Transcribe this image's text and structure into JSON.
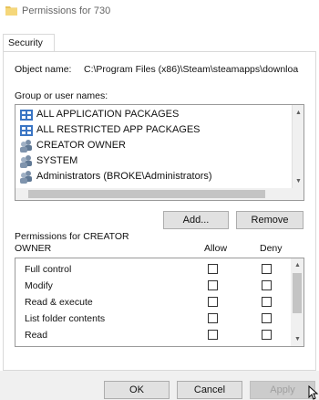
{
  "window": {
    "title": "Permissions for 730"
  },
  "tabs": [
    {
      "label": "Security"
    }
  ],
  "object": {
    "label": "Object name:",
    "value": "C:\\Program Files (x86)\\Steam\\steamapps\\downloa"
  },
  "groups": {
    "label": "Group or user names:",
    "items": [
      {
        "name": "ALL APPLICATION PACKAGES",
        "icon": "package-group-icon"
      },
      {
        "name": "ALL RESTRICTED APP PACKAGES",
        "icon": "package-group-icon"
      },
      {
        "name": "CREATOR OWNER",
        "icon": "users-icon"
      },
      {
        "name": "SYSTEM",
        "icon": "users-icon"
      },
      {
        "name": "Administrators (BROKE\\Administrators)",
        "icon": "users-icon"
      }
    ]
  },
  "buttons": {
    "add": "Add...",
    "remove": "Remove",
    "ok": "OK",
    "cancel": "Cancel",
    "apply": "Apply"
  },
  "permissions": {
    "label_line1": "Permissions for CREATOR",
    "label_line2": "OWNER",
    "allow_header": "Allow",
    "deny_header": "Deny",
    "rows": [
      {
        "name": "Full control",
        "allow": false,
        "deny": false
      },
      {
        "name": "Modify",
        "allow": false,
        "deny": false
      },
      {
        "name": "Read & execute",
        "allow": false,
        "deny": false
      },
      {
        "name": "List folder contents",
        "allow": false,
        "deny": false
      },
      {
        "name": "Read",
        "allow": false,
        "deny": false
      }
    ]
  }
}
